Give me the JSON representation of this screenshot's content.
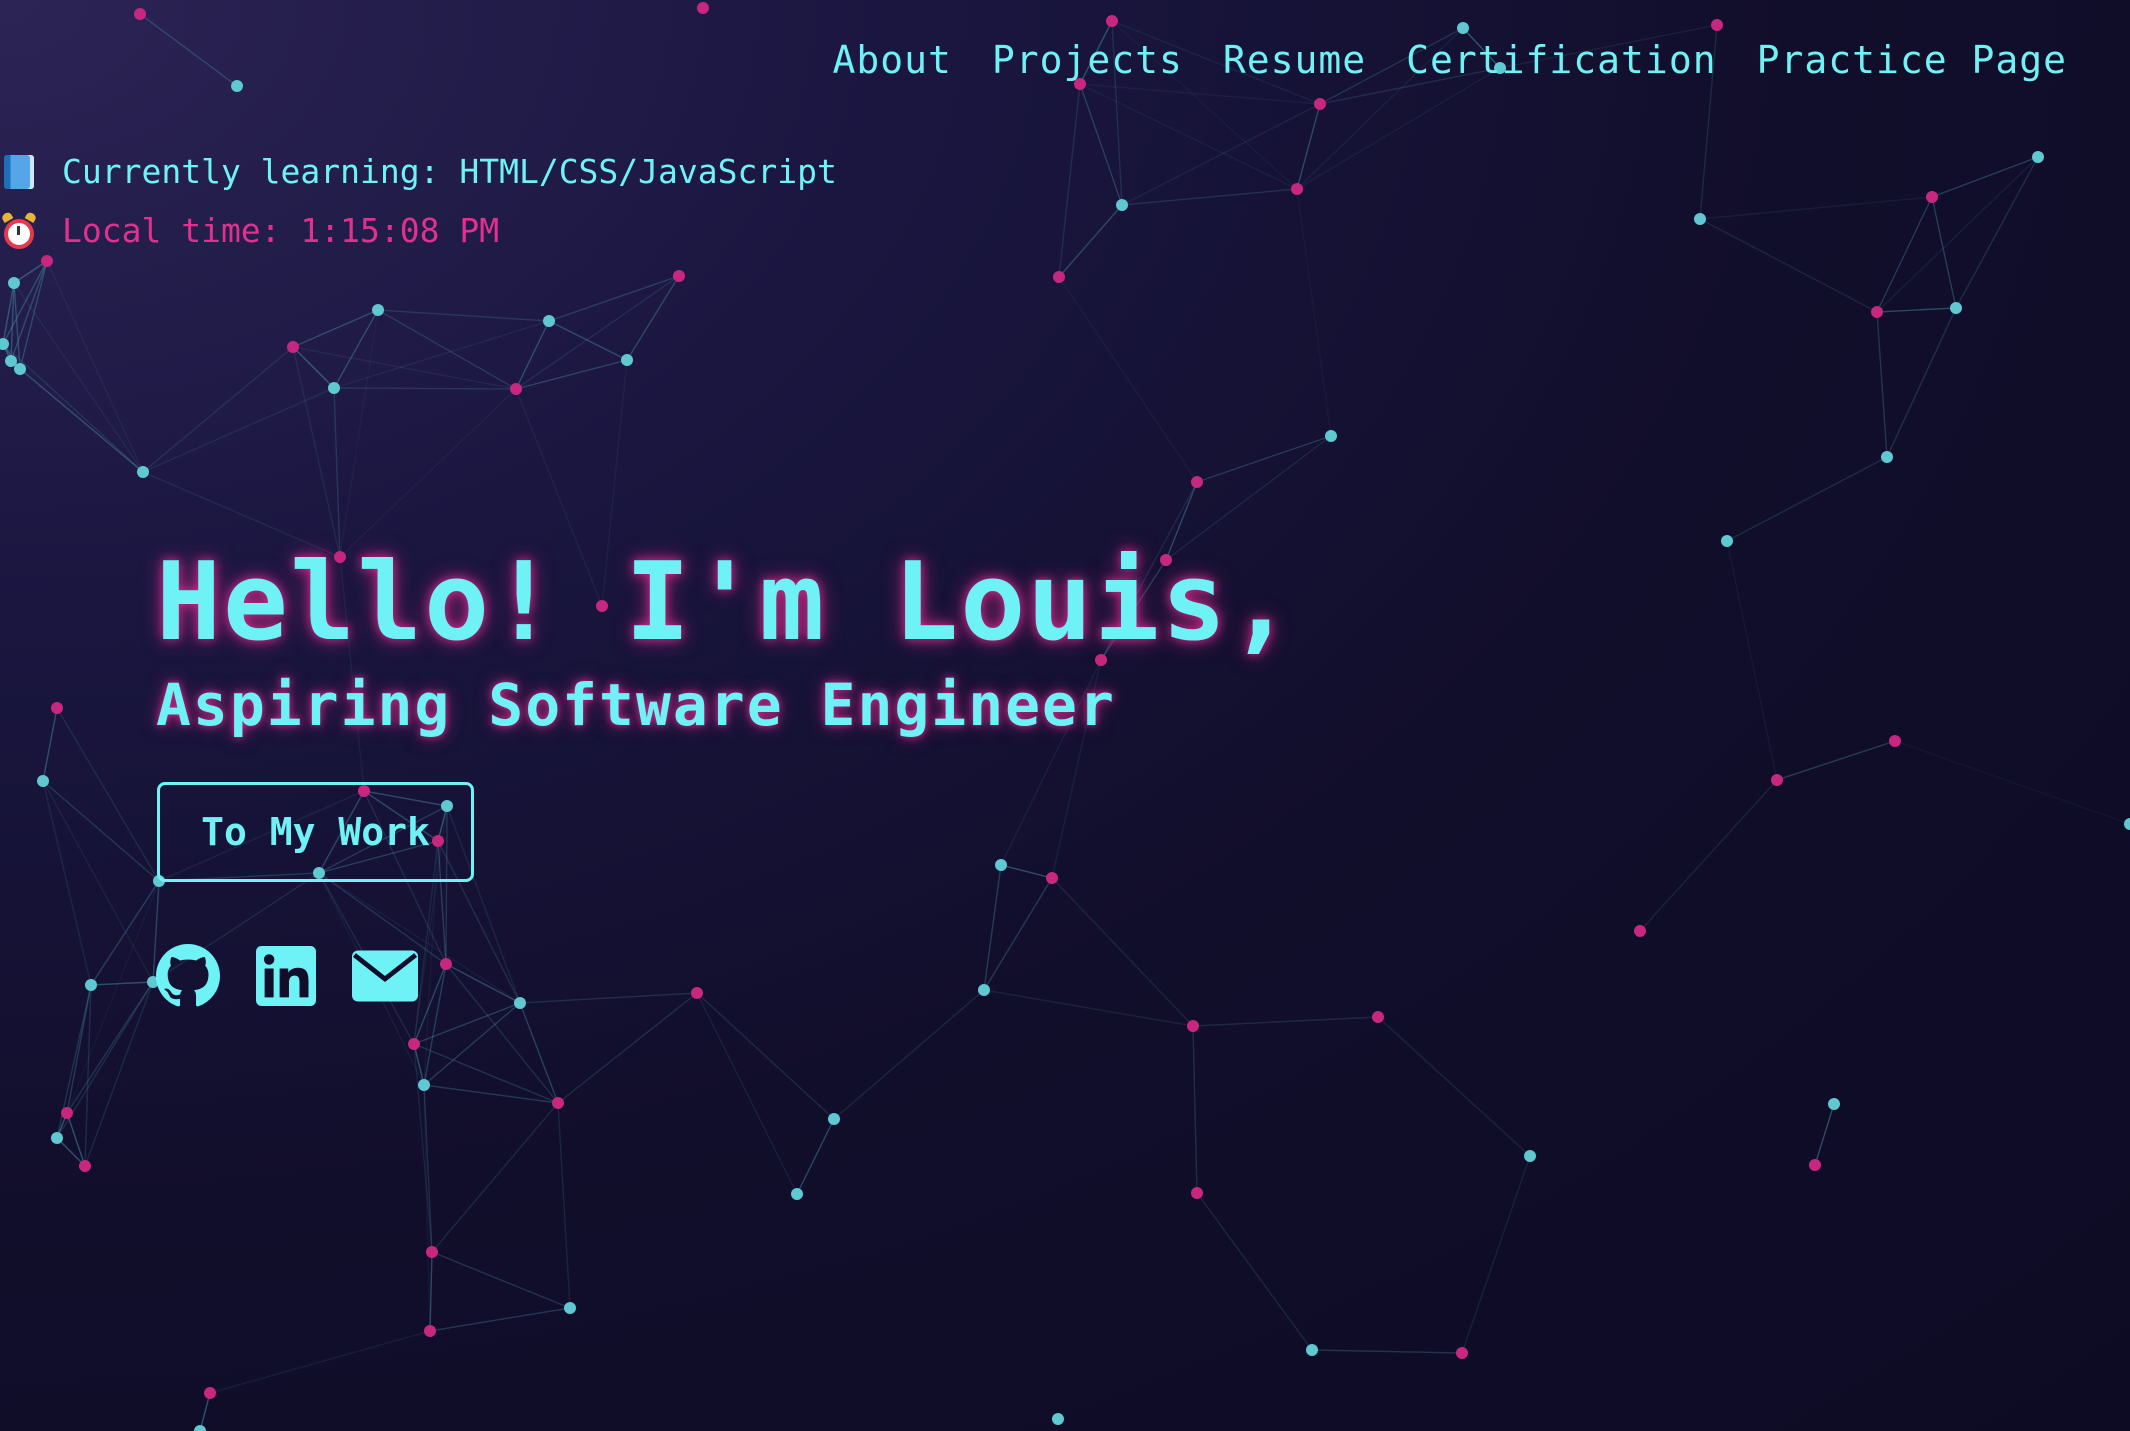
{
  "nav": {
    "items": [
      "About",
      "Projects",
      "Resume",
      "Certification",
      "Practice Page"
    ]
  },
  "status": {
    "learning_text": "Currently learning: HTML/CSS/JavaScript",
    "learning_icon": "book-icon",
    "time_text": "Local time: 1:15:08 PM",
    "time_icon": "alarm-clock-icon"
  },
  "hero": {
    "greeting": "Hello! I'm Louis,",
    "subtitle": "Aspiring Software Engineer",
    "cta_label": "To My Work"
  },
  "socials": [
    {
      "name": "github-icon"
    },
    {
      "name": "linkedin-icon"
    },
    {
      "name": "email-icon"
    }
  ],
  "colors": {
    "accent_cyan": "#6ff2f5",
    "accent_pink": "#e0318f",
    "node_cyan": "#5fc8d0",
    "node_pink": "#c7277e",
    "background_dark": "#0d0b24",
    "background_light": "#2c2455"
  }
}
